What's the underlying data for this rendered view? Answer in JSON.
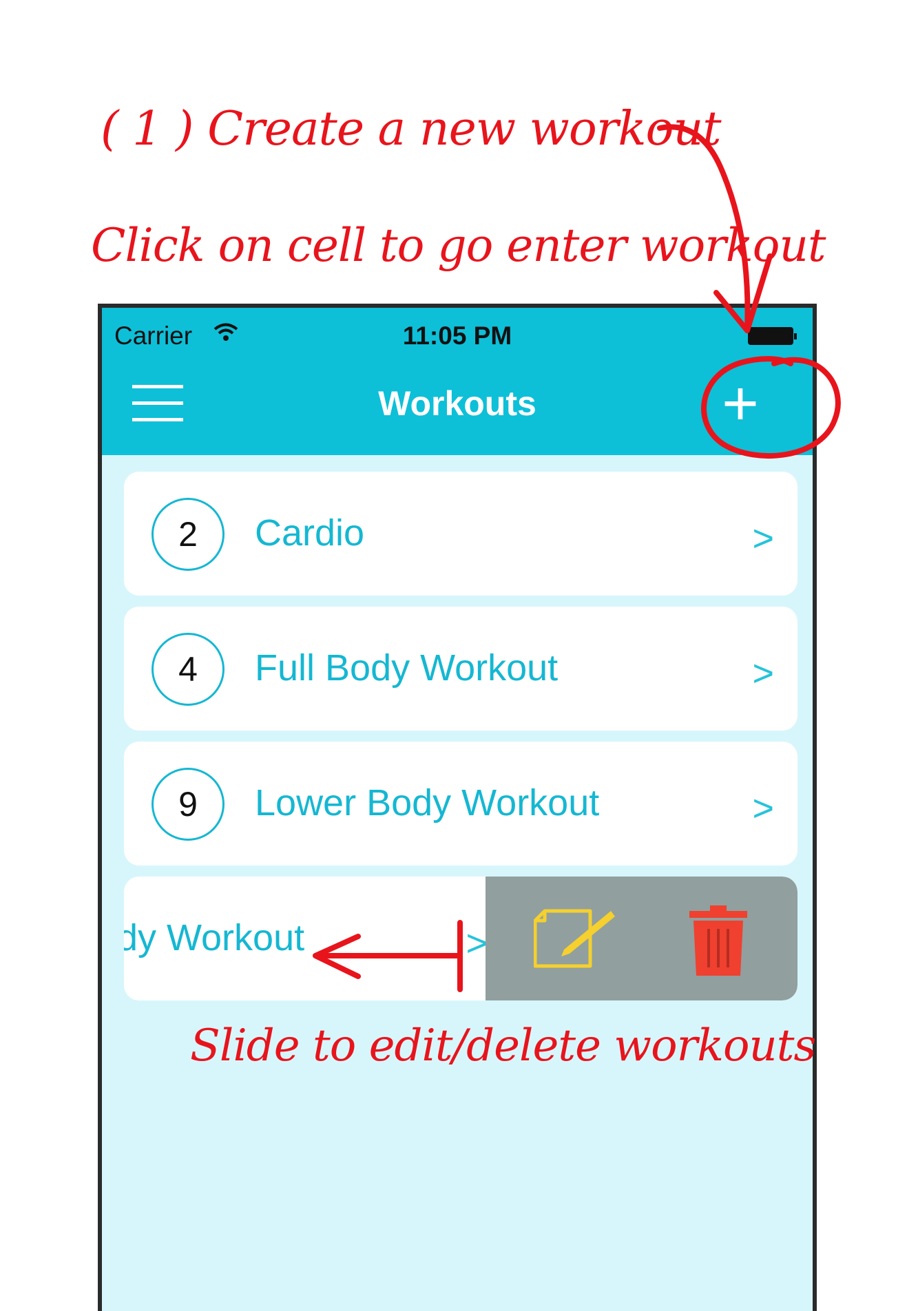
{
  "annotations": {
    "create": "( 1 ) Create a new workout",
    "click": "Click on cell to go enter workout",
    "slide": "Slide to edit/delete workouts"
  },
  "status_bar": {
    "carrier": "Carrier",
    "time": "11:05 PM"
  },
  "navbar": {
    "title": "Workouts",
    "add_label": "+"
  },
  "workouts": [
    {
      "count": "2",
      "name": "Cardio",
      "chevron": ">"
    },
    {
      "count": "4",
      "name": "Full Body Workout",
      "chevron": ">"
    },
    {
      "count": "9",
      "name": "Lower Body Workout",
      "chevron": ">"
    }
  ],
  "slid_cell": {
    "name": "dy Workout",
    "chevron": ">"
  },
  "colors": {
    "accent": "#0ebfd8",
    "background": "#d7f6fc",
    "annotation": "#e8141c",
    "actions_bg": "#919f9e",
    "edit": "#f5d02e",
    "delete": "#f0402f"
  }
}
